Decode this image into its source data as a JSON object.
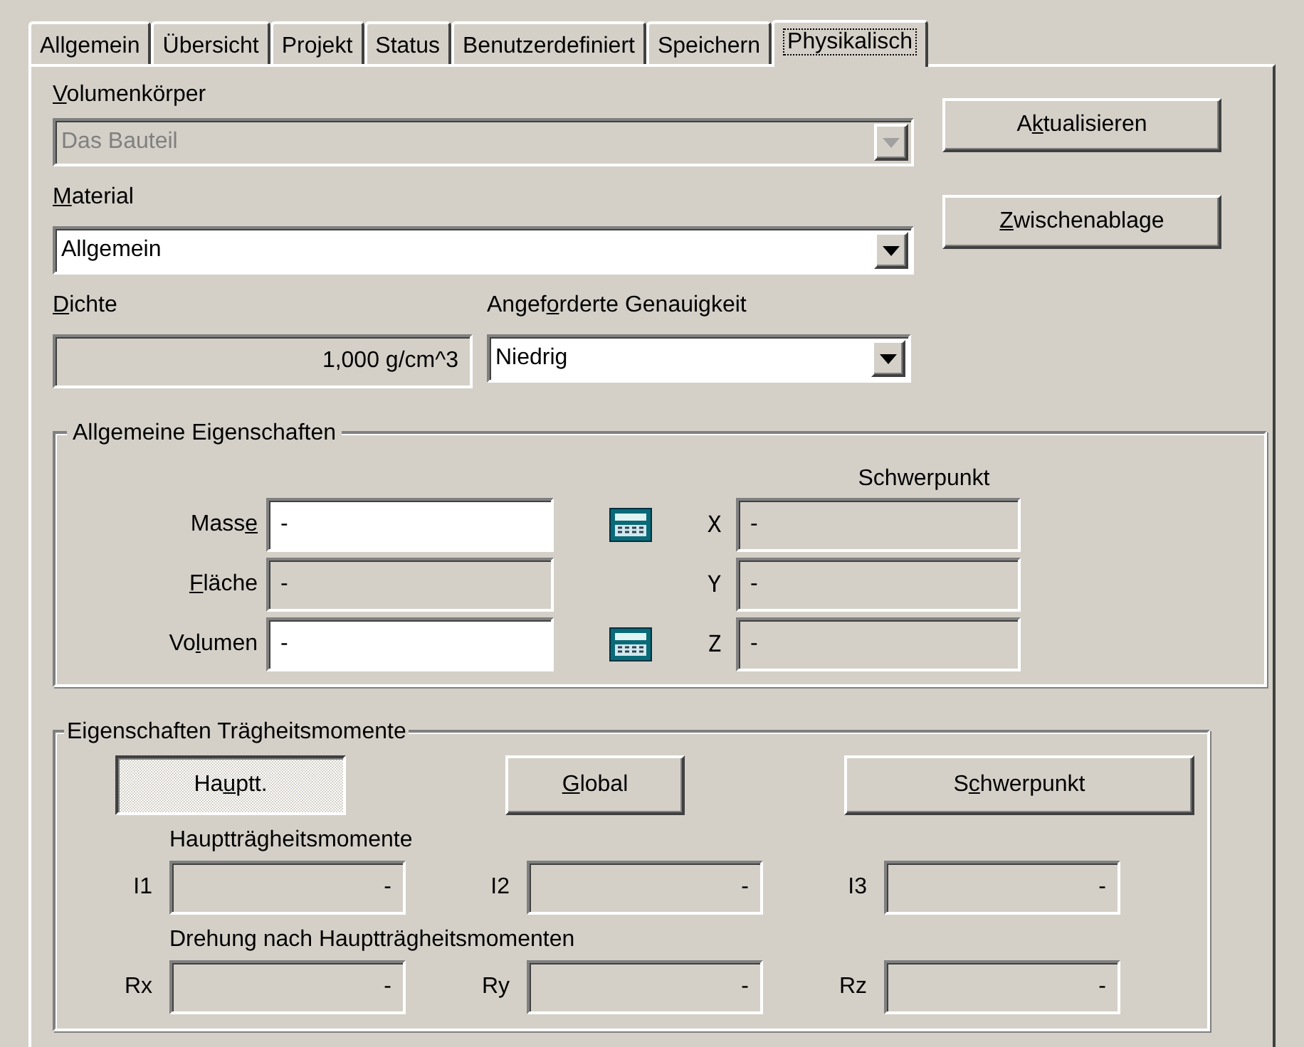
{
  "tabs": [
    {
      "label": "Allgemein",
      "selected": false
    },
    {
      "label": "Übersicht",
      "selected": false
    },
    {
      "label": "Projekt",
      "selected": false
    },
    {
      "label": "Status",
      "selected": false
    },
    {
      "label": "Benutzerdefiniert",
      "selected": false
    },
    {
      "label": "Speichern",
      "selected": false
    },
    {
      "label": "Physikalisch",
      "selected": true
    }
  ],
  "solid_body": {
    "label": {
      "key": "V",
      "after": "olumenkörper"
    },
    "value": "Das Bauteil",
    "disabled": true
  },
  "material": {
    "label": {
      "key": "M",
      "after": "aterial"
    },
    "value": "Allgemein",
    "disabled": false
  },
  "density": {
    "label": {
      "key": "D",
      "after": "ichte"
    },
    "value": "1,000 g/cm^3"
  },
  "accuracy": {
    "label": {
      "before": "Angef",
      "key": "o",
      "after": "rderte Genauigkeit"
    },
    "value": "Niedrig"
  },
  "buttons": [
    {
      "label": {
        "before": "A",
        "key": "k",
        "after": "tualisieren"
      }
    },
    {
      "label": {
        "key": "Z",
        "after": "wischenablage"
      }
    }
  ],
  "general": {
    "title": "Allgemeine Eigenschaften",
    "centroid_heading": "Schwerpunkt",
    "rows": [
      {
        "label": {
          "before": "Mass",
          "key": "e"
        },
        "value": "-",
        "editable": true,
        "calculator": true,
        "axis": "X",
        "axis_value": "-"
      },
      {
        "label": {
          "key": "F",
          "after": "läche"
        },
        "value": "-",
        "editable": false,
        "calculator": false,
        "axis": "Y",
        "axis_value": "-"
      },
      {
        "label": {
          "before": "Vo",
          "key": "l",
          "after": "umen"
        },
        "value": "-",
        "editable": true,
        "calculator": true,
        "axis": "Z",
        "axis_value": "-"
      }
    ]
  },
  "inertia": {
    "title": "Eigenschaften Trägheitsmomente",
    "buttons": [
      {
        "label": {
          "before": "Ha",
          "key": "u",
          "after": "ptt."
        },
        "selected": true
      },
      {
        "label": {
          "key": "G",
          "after": "lobal"
        },
        "selected": false
      },
      {
        "label": {
          "before": "S",
          "key": "c",
          "after": "hwerpunkt"
        },
        "selected": false
      }
    ],
    "principal_heading": "Hauptträgheitsmomente",
    "principal": [
      {
        "label": "I1",
        "value": "-"
      },
      {
        "label": "I2",
        "value": "-"
      },
      {
        "label": "I3",
        "value": "-"
      }
    ],
    "rotation_heading": "Drehung nach Hauptträgheitsmomenten",
    "rotation": [
      {
        "label": "Rx",
        "value": "-"
      },
      {
        "label": "Ry",
        "value": "-"
      },
      {
        "label": "Rz",
        "value": "-"
      }
    ]
  }
}
